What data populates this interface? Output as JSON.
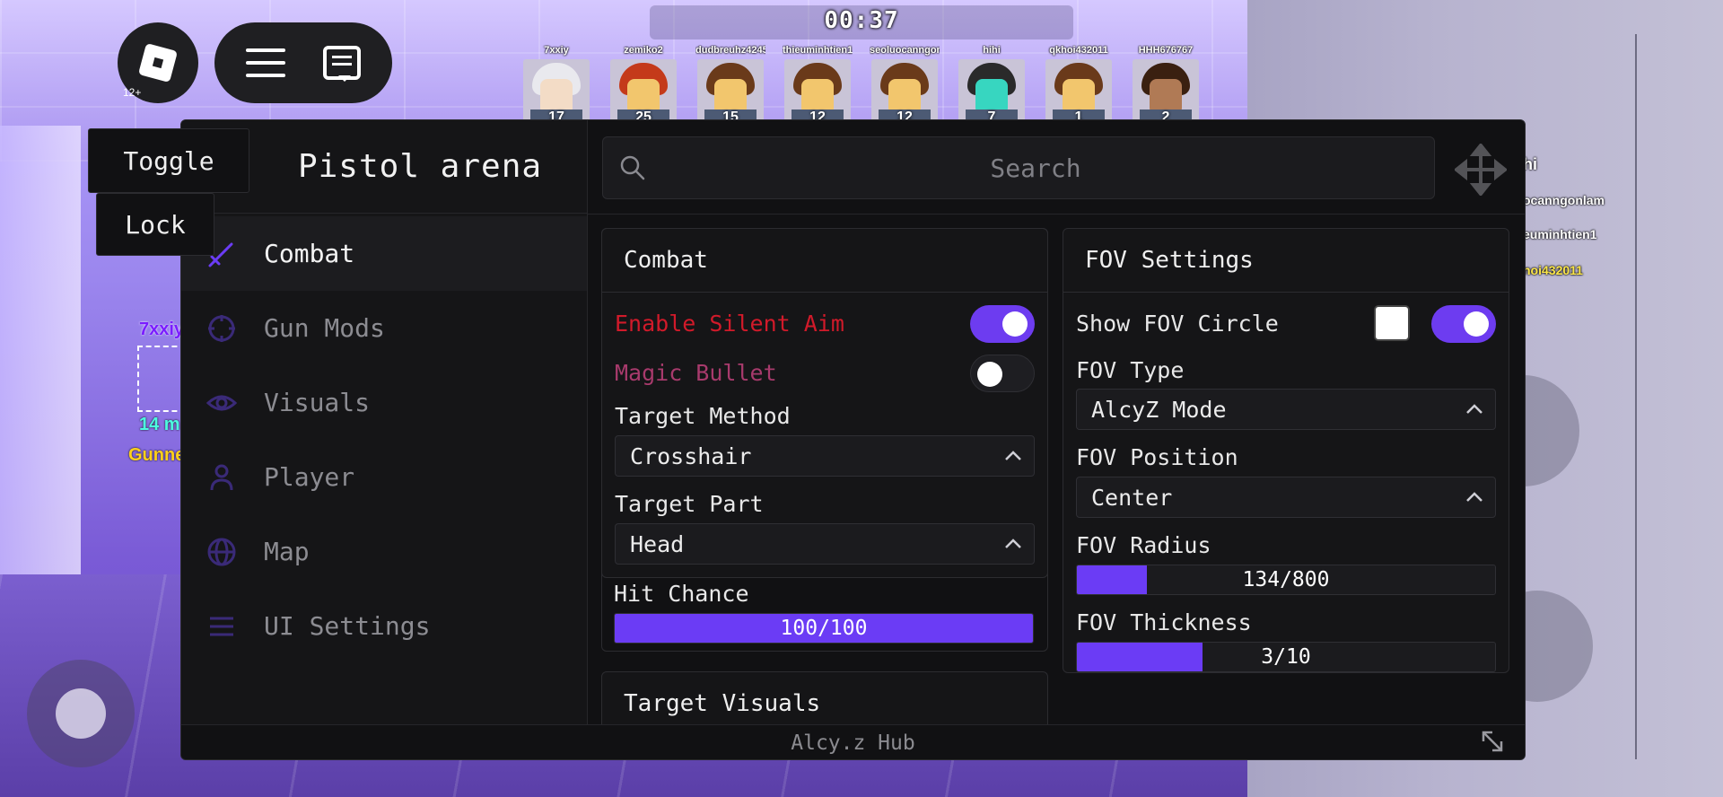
{
  "game": {
    "timer": "00:37",
    "age_rating": "12+",
    "players": [
      {
        "name": "7xxiy",
        "score": "17",
        "skin": "white"
      },
      {
        "name": "zemiko2",
        "score": "25",
        "skin": "red"
      },
      {
        "name": "dudbreuhz4245",
        "score": "15",
        "skin": "brown"
      },
      {
        "name": "thieuminhtien1",
        "score": "12",
        "skin": "brown"
      },
      {
        "name": "seoluocanngonlam",
        "score": "12",
        "skin": "brown"
      },
      {
        "name": "hihi",
        "score": "7",
        "skin": "teal"
      },
      {
        "name": "qkhoi432011",
        "score": "1",
        "skin": "brown"
      },
      {
        "name": "HHH676767",
        "score": "2",
        "skin": "dark"
      }
    ],
    "right_names": [
      "hi",
      "ocanngonlam",
      "euminhtien1",
      "noi432011"
    ],
    "target_name": "7xxiy",
    "target_distance": "14 m",
    "target_gun": "Gunne"
  },
  "window": {
    "title": "Pistol arena",
    "search_placeholder": "Search",
    "footer": "Alcy.z Hub",
    "accent": "#6b3cf5"
  },
  "floating": {
    "toggle": "Toggle",
    "lock": "Lock"
  },
  "sidebar": {
    "items": [
      {
        "label": "Combat",
        "icon": "sword-icon",
        "active": true
      },
      {
        "label": "Gun Mods",
        "icon": "crosshair-icon",
        "active": false
      },
      {
        "label": "Visuals",
        "icon": "eye-icon",
        "active": false
      },
      {
        "label": "Player",
        "icon": "user-icon",
        "active": false
      },
      {
        "label": "Map",
        "icon": "globe-icon",
        "active": false
      },
      {
        "label": "UI Settings",
        "icon": "list-icon",
        "active": false
      }
    ]
  },
  "combat": {
    "title": "Combat",
    "silent_aim": {
      "label": "Enable Silent Aim",
      "on": true
    },
    "magic_bullet": {
      "label": "Magic Bullet",
      "on": false
    },
    "target_method": {
      "label": "Target Method",
      "value": "Crosshair"
    },
    "target_part": {
      "label": "Target Part",
      "value": "Head"
    },
    "hit_chance": {
      "label": "Hit Chance",
      "text": "100/100",
      "value": 100,
      "max": 100
    }
  },
  "target_visuals": {
    "title": "Target Visuals"
  },
  "fov": {
    "title": "FOV Settings",
    "show_circle": {
      "label": "Show FOV Circle",
      "on": true,
      "color": "#ffffff"
    },
    "fov_type": {
      "label": "FOV Type",
      "value": "AlcyZ Mode"
    },
    "fov_position": {
      "label": "FOV Position",
      "value": "Center"
    },
    "radius": {
      "label": "FOV Radius",
      "text": "134/800",
      "value": 134,
      "max": 800
    },
    "thickness": {
      "label": "FOV Thickness",
      "text": "3/10",
      "value": 3,
      "max": 10
    }
  }
}
